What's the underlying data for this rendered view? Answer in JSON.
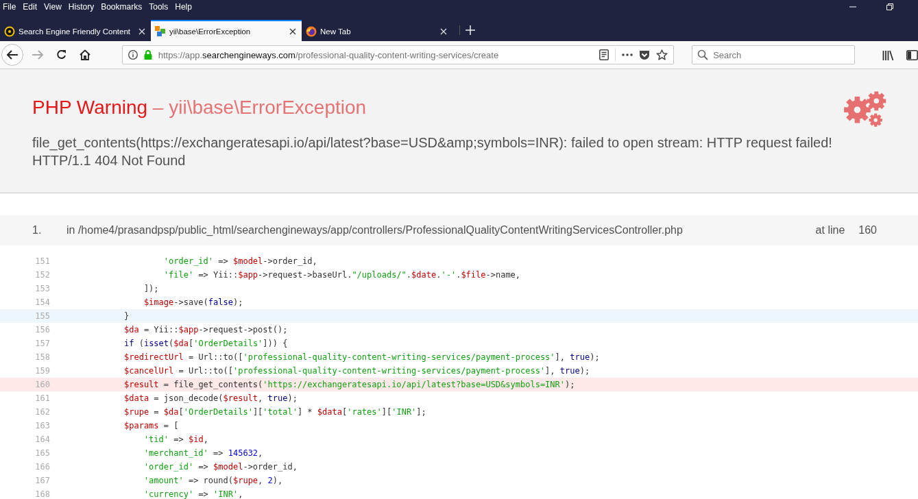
{
  "menu_bar": {
    "items": [
      "File",
      "Edit",
      "View",
      "History",
      "Bookmarks",
      "Tools",
      "Help"
    ]
  },
  "tabs": [
    {
      "title": "Search Engine Friendly Content",
      "selected": false
    },
    {
      "title": "yii\\base\\ErrorException",
      "selected": true
    },
    {
      "title": "New Tab",
      "selected": false
    }
  ],
  "address_bar": {
    "prefix": "https://app.",
    "domain": "searchengineways.com",
    "path": "/professional-quality-content-writing-services/create"
  },
  "search": {
    "placeholder": "Search"
  },
  "error": {
    "type": "PHP Warning",
    "separator": " – ",
    "class": "yii\\base\\ErrorException",
    "message": "file_get_contents(https://exchangeratesapi.io/api/latest?base=USD&amp;symbols=INR): failed to open stream: HTTP request failed! HTTP/1.1 404 Not Found"
  },
  "call_stack": [
    {
      "index": "1.",
      "file": "in /home4/prasandpsp/public_html/searchengineways/app/controllers/ProfessionalQualityContentWritingServicesController.php",
      "at_label": "at line",
      "line": "160"
    }
  ],
  "code_lines": [
    {
      "number": "151",
      "kind": "plain",
      "tokens": [
        {
          "kind": "s",
          "text": "        'order_id'"
        },
        {
          "kind": "p",
          "text": " => "
        },
        {
          "kind": "v",
          "text": "$model"
        },
        {
          "kind": "p",
          "text": "->order_id,"
        }
      ]
    },
    {
      "number": "152",
      "kind": "plain",
      "tokens": [
        {
          "kind": "s",
          "text": "        'file'"
        },
        {
          "kind": "p",
          "text": " => Yii::"
        },
        {
          "kind": "v",
          "text": "$app"
        },
        {
          "kind": "p",
          "text": "->request->baseUrl."
        },
        {
          "kind": "s",
          "text": "\"/uploads/\""
        },
        {
          "kind": "p",
          "text": "."
        },
        {
          "kind": "v",
          "text": "$date"
        },
        {
          "kind": "p",
          "text": "."
        },
        {
          "kind": "s",
          "text": "'-'"
        },
        {
          "kind": "p",
          "text": "."
        },
        {
          "kind": "v",
          "text": "$file"
        },
        {
          "kind": "p",
          "text": "->name,"
        }
      ]
    },
    {
      "number": "153",
      "kind": "plain",
      "tokens": [
        {
          "kind": "p",
          "text": "    ]);"
        }
      ]
    },
    {
      "number": "154",
      "kind": "plain",
      "tokens": [
        {
          "kind": "v",
          "text": "    $image"
        },
        {
          "kind": "p",
          "text": "->save("
        },
        {
          "kind": "k",
          "text": "false"
        },
        {
          "kind": "p",
          "text": ");"
        }
      ]
    },
    {
      "number": "155",
      "kind": "hover",
      "tokens": [
        {
          "kind": "p",
          "text": "}"
        }
      ]
    },
    {
      "number": "156",
      "kind": "plain",
      "tokens": [
        {
          "kind": "v",
          "text": "$da"
        },
        {
          "kind": "p",
          "text": " = Yii::"
        },
        {
          "kind": "v",
          "text": "$app"
        },
        {
          "kind": "p",
          "text": "->request->post();"
        }
      ]
    },
    {
      "number": "157",
      "kind": "plain",
      "tokens": [
        {
          "kind": "k",
          "text": "if"
        },
        {
          "kind": "p",
          "text": " ("
        },
        {
          "kind": "k",
          "text": "isset"
        },
        {
          "kind": "p",
          "text": "("
        },
        {
          "kind": "v",
          "text": "$da"
        },
        {
          "kind": "p",
          "text": "["
        },
        {
          "kind": "s",
          "text": "'OrderDetails'"
        },
        {
          "kind": "p",
          "text": "])) {"
        }
      ]
    },
    {
      "number": "158",
      "kind": "plain",
      "tokens": [
        {
          "kind": "v",
          "text": "$redirectUrl"
        },
        {
          "kind": "p",
          "text": " = Url::to(["
        },
        {
          "kind": "s",
          "text": "'professional-quality-content-writing-services/payment-process'"
        },
        {
          "kind": "p",
          "text": "], "
        },
        {
          "kind": "k",
          "text": "true"
        },
        {
          "kind": "p",
          "text": ");"
        }
      ]
    },
    {
      "number": "159",
      "kind": "plain",
      "tokens": [
        {
          "kind": "v",
          "text": "$cancelUrl"
        },
        {
          "kind": "p",
          "text": " = Url::to(["
        },
        {
          "kind": "s",
          "text": "'professional-quality-content-writing-services/payment-process'"
        },
        {
          "kind": "p",
          "text": "], "
        },
        {
          "kind": "k",
          "text": "true"
        },
        {
          "kind": "p",
          "text": ");"
        }
      ]
    },
    {
      "number": "160",
      "kind": "error",
      "tokens": [
        {
          "kind": "v",
          "text": "$result"
        },
        {
          "kind": "p",
          "text": " = file_get_contents("
        },
        {
          "kind": "s",
          "text": "'https://exchangeratesapi.io/api/latest?base=USD&symbols=INR'"
        },
        {
          "kind": "p",
          "text": ");"
        }
      ]
    },
    {
      "number": "161",
      "kind": "plain",
      "tokens": [
        {
          "kind": "v",
          "text": "$data"
        },
        {
          "kind": "p",
          "text": " = json_decode("
        },
        {
          "kind": "v",
          "text": "$result"
        },
        {
          "kind": "p",
          "text": ", "
        },
        {
          "kind": "k",
          "text": "true"
        },
        {
          "kind": "p",
          "text": ");"
        }
      ]
    },
    {
      "number": "162",
      "kind": "plain",
      "tokens": [
        {
          "kind": "v",
          "text": "$rupe"
        },
        {
          "kind": "p",
          "text": " = "
        },
        {
          "kind": "v",
          "text": "$da"
        },
        {
          "kind": "p",
          "text": "["
        },
        {
          "kind": "s",
          "text": "'OrderDetails'"
        },
        {
          "kind": "p",
          "text": "]["
        },
        {
          "kind": "s",
          "text": "'total'"
        },
        {
          "kind": "p",
          "text": "] * "
        },
        {
          "kind": "v",
          "text": "$data"
        },
        {
          "kind": "p",
          "text": "["
        },
        {
          "kind": "s",
          "text": "'rates'"
        },
        {
          "kind": "p",
          "text": "]["
        },
        {
          "kind": "s",
          "text": "'INR'"
        },
        {
          "kind": "p",
          "text": "];"
        }
      ]
    },
    {
      "number": "163",
      "kind": "plain",
      "tokens": [
        {
          "kind": "v",
          "text": "$params"
        },
        {
          "kind": "p",
          "text": " = ["
        }
      ]
    },
    {
      "number": "164",
      "kind": "plain",
      "tokens": [
        {
          "kind": "s",
          "text": "    'tid'"
        },
        {
          "kind": "p",
          "text": " => "
        },
        {
          "kind": "v",
          "text": "$id"
        },
        {
          "kind": "p",
          "text": ","
        }
      ]
    },
    {
      "number": "165",
      "kind": "plain",
      "tokens": [
        {
          "kind": "s",
          "text": "    'merchant_id'"
        },
        {
          "kind": "p",
          "text": " => "
        },
        {
          "kind": "n",
          "text": "145632"
        },
        {
          "kind": "p",
          "text": ","
        }
      ]
    },
    {
      "number": "166",
      "kind": "plain",
      "tokens": [
        {
          "kind": "s",
          "text": "    'order_id'"
        },
        {
          "kind": "p",
          "text": " => "
        },
        {
          "kind": "v",
          "text": "$model"
        },
        {
          "kind": "p",
          "text": "->order_id,"
        }
      ]
    },
    {
      "number": "167",
      "kind": "plain",
      "tokens": [
        {
          "kind": "s",
          "text": "    'amount'"
        },
        {
          "kind": "p",
          "text": " => round("
        },
        {
          "kind": "v",
          "text": "$rupe"
        },
        {
          "kind": "p",
          "text": ", "
        },
        {
          "kind": "n",
          "text": "2"
        },
        {
          "kind": "p",
          "text": "),"
        }
      ]
    },
    {
      "number": "168",
      "kind": "plain",
      "tokens": [
        {
          "kind": "s",
          "text": "    'currency'"
        },
        {
          "kind": "p",
          "text": " => "
        },
        {
          "kind": "s",
          "text": "'INR'"
        },
        {
          "kind": "p",
          "text": ","
        }
      ]
    }
  ]
}
